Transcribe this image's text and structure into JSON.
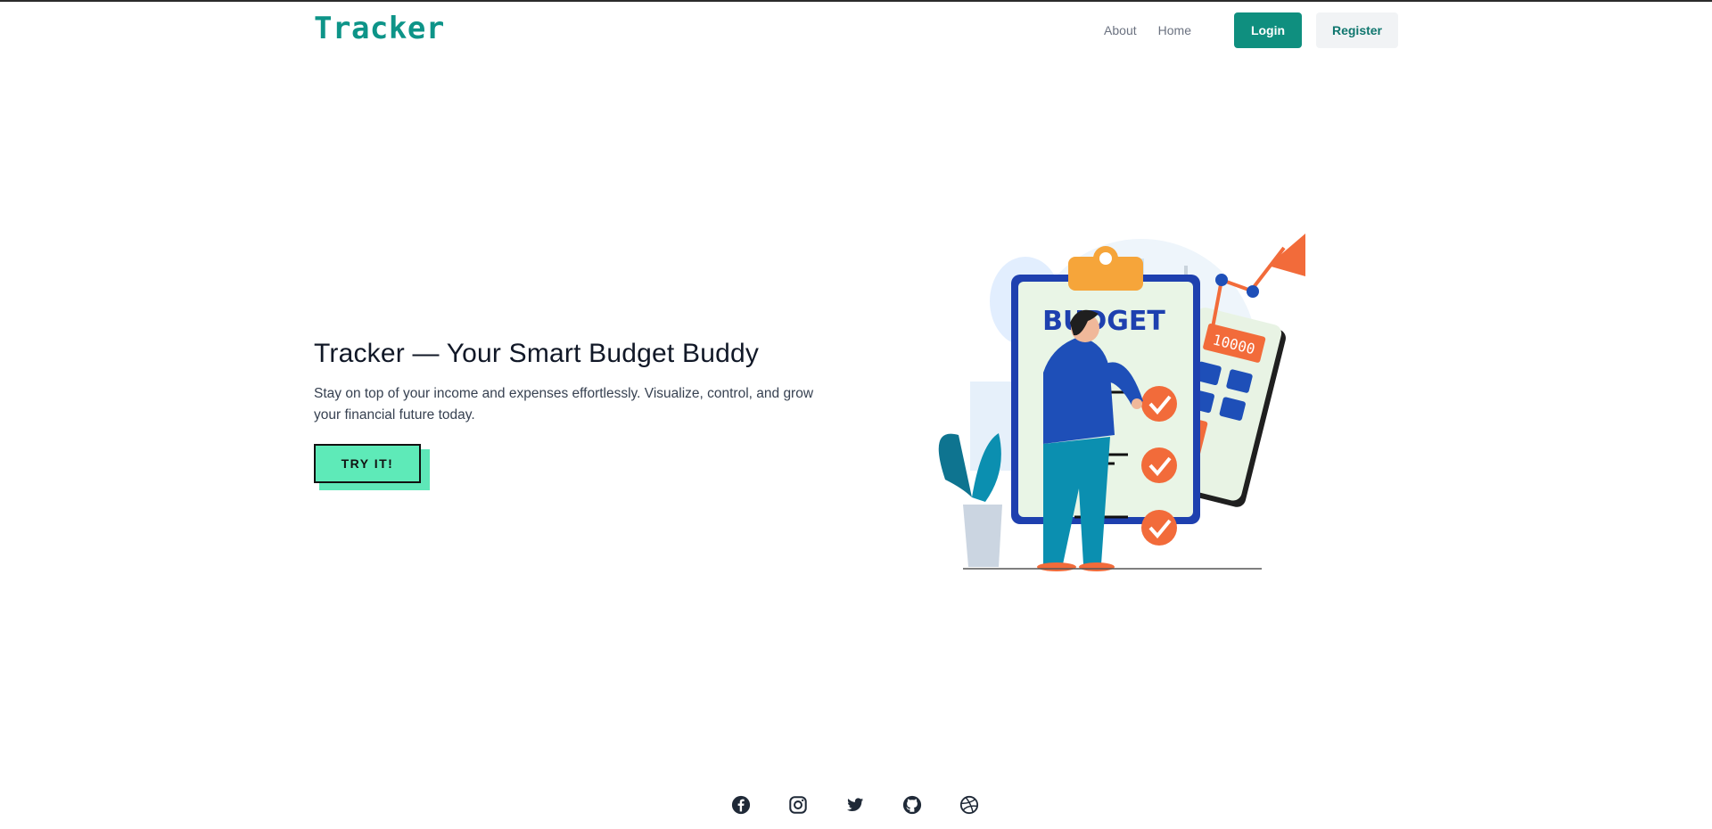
{
  "nav": {
    "brand": "Tracker",
    "links": [
      "About",
      "Home"
    ],
    "login_label": "Login",
    "register_label": "Register"
  },
  "hero": {
    "title": "Tracker — Your Smart Budget Buddy",
    "subtitle": "Stay on top of your income and expenses effortlessly. Visualize, control, and grow your financial future today.",
    "cta_label": "TRY IT!"
  },
  "illustration": {
    "board_text": "BUDGET",
    "calculator_display": "10000"
  },
  "footer": {
    "social_icons": [
      "facebook-icon",
      "instagram-icon",
      "twitter-icon",
      "github-icon",
      "dribbble-icon"
    ]
  },
  "colors": {
    "brand": "#0d9488",
    "cta": "#5eeab8",
    "accent_orange": "#f26b3a",
    "illustration_blue": "#1e40af"
  }
}
